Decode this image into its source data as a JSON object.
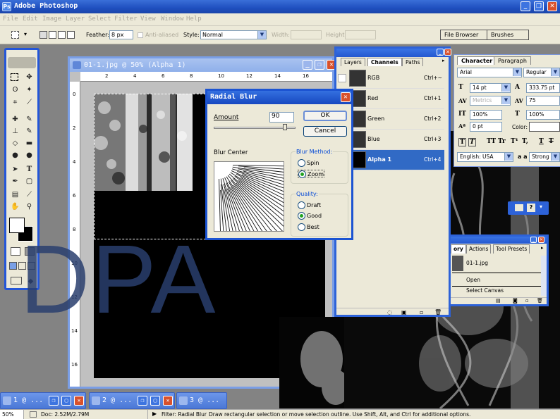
{
  "app": {
    "title": "Adobe Photoshop"
  },
  "menu": [
    "File",
    "Edit",
    "Image",
    "Layer",
    "Select",
    "Filter",
    "View",
    "Window",
    "Help"
  ],
  "options": {
    "feather_label": "Feather:",
    "feather_value": "8 px",
    "antialias_label": "Anti-aliased",
    "style_label": "Style:",
    "style_value": "Normal",
    "width_label": "Width:",
    "height_label": "Height:",
    "well_tabs": [
      "File Browser",
      "Brushes"
    ]
  },
  "document": {
    "title": "01-1.jpg @ 50% (Alpha 1)",
    "ruler_top": [
      "2",
      "4",
      "6",
      "8",
      "10",
      "12",
      "14",
      "16"
    ],
    "ruler_left": [
      "0",
      "2",
      "4",
      "6",
      "8",
      "10",
      "12",
      "14",
      "16"
    ]
  },
  "dialog": {
    "title": "Radial Blur",
    "amount_label": "Amount",
    "amount_value": "90",
    "amount_fraction": 0.9,
    "ok": "OK",
    "cancel": "Cancel",
    "blur_center_label": "Blur Center",
    "blur_method_label": "Blur Method:",
    "methods": [
      {
        "label": "Spin",
        "selected": false
      },
      {
        "label": "Zoom",
        "selected": true
      }
    ],
    "quality_label": "Quality:",
    "qualities": [
      {
        "label": "Draft",
        "selected": false
      },
      {
        "label": "Good",
        "selected": true
      },
      {
        "label": "Best",
        "selected": false
      }
    ]
  },
  "channels_palette": {
    "tabs": [
      "Layers",
      "Channels",
      "Paths"
    ],
    "active_tab": "Channels",
    "rows": [
      {
        "name": "RGB",
        "shortcut": "Ctrl+~",
        "selected": false
      },
      {
        "name": "Red",
        "shortcut": "Ctrl+1",
        "selected": false
      },
      {
        "name": "Green",
        "shortcut": "Ctrl+2",
        "selected": false
      },
      {
        "name": "Blue",
        "shortcut": "Ctrl+3",
        "selected": false
      },
      {
        "name": "Alpha 1",
        "shortcut": "Ctrl+4",
        "selected": true
      }
    ]
  },
  "character_palette": {
    "tabs": [
      "Character",
      "Paragraph"
    ],
    "font": "Arial",
    "style": "Regular",
    "size": "14 pt",
    "leading": "333.75 pt",
    "kerning": "Metrics",
    "tracking": "75",
    "vscale": "100%",
    "hscale": "100%",
    "baseline": "0 pt",
    "color_label": "Color:",
    "language": "English: USA",
    "antialias_label": "a a",
    "antialias": "Strong",
    "type_buttons": [
      "T",
      "T",
      "TT",
      "Tr",
      "T¹",
      "T,",
      "T",
      "T"
    ]
  },
  "history_palette": {
    "tabs": [
      "ory",
      "Actions",
      "Tool Presets"
    ],
    "snapshot": "01-1.jpg",
    "rows": [
      "Open",
      "Select Canvas"
    ]
  },
  "minimized": [
    {
      "title": "1 @ ..."
    },
    {
      "title": "2 @ ..."
    },
    {
      "title": "3 @ ..."
    }
  ],
  "status": {
    "zoom": "50%",
    "doc": "Doc: 2.52M/2.79M",
    "filter": "Filter: Radial Blur",
    "hint": "Draw rectangular selection or move selection outline.  Use Shift, Alt, and Ctrl for additional options."
  },
  "watermark": "DPA",
  "colors": {
    "title_blue": "#1f4fbf",
    "selection_blue": "#316ac5",
    "panel_bg": "#ece9d8",
    "close_red": "#d9512c"
  }
}
